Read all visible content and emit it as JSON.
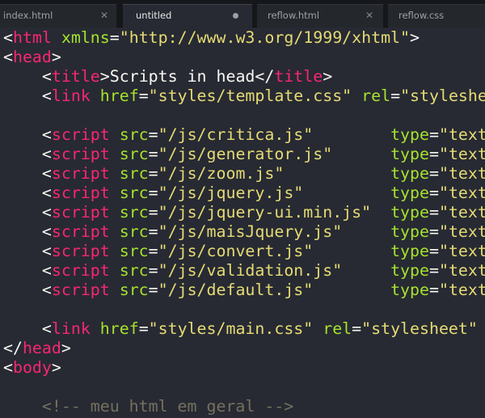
{
  "tabs": [
    {
      "label": "index.html",
      "active": false,
      "dirty": false
    },
    {
      "label": "untitled",
      "active": true,
      "dirty": true
    },
    {
      "label": "reflow.html",
      "active": false,
      "dirty": false
    },
    {
      "label": "reflow.css",
      "active": false,
      "dirty": false
    }
  ],
  "icons": {
    "close": "close-icon",
    "dirty": "unsaved-dot-icon"
  },
  "theme": {
    "tag": "#f92672",
    "attribute": "#a6e22e",
    "string": "#e6db74",
    "text": "#f8f8f2",
    "comment": "#75715e",
    "background": "#272a33"
  },
  "code_lines": [
    [
      [
        "p",
        "<"
      ],
      [
        "tag",
        "html"
      ],
      [
        "p",
        " "
      ],
      [
        "attr",
        "xmlns"
      ],
      [
        "p",
        "="
      ],
      [
        "str",
        "\"http://www.w3.org/1999/xhtml\""
      ],
      [
        "p",
        ">"
      ]
    ],
    [
      [
        "p",
        "<"
      ],
      [
        "tag",
        "head"
      ],
      [
        "p",
        ">"
      ]
    ],
    [
      [
        "p",
        "    <"
      ],
      [
        "tag",
        "title"
      ],
      [
        "p",
        ">"
      ],
      [
        "text",
        "Scripts in head"
      ],
      [
        "p",
        "</"
      ],
      [
        "tag",
        "title"
      ],
      [
        "p",
        ">"
      ]
    ],
    [
      [
        "p",
        "    <"
      ],
      [
        "tag",
        "link"
      ],
      [
        "p",
        " "
      ],
      [
        "attr",
        "href"
      ],
      [
        "p",
        "="
      ],
      [
        "str",
        "\"styles/template.css\""
      ],
      [
        "p",
        " "
      ],
      [
        "attr",
        "rel"
      ],
      [
        "p",
        "="
      ],
      [
        "str",
        "\"styleshe"
      ]
    ],
    [
      [
        "p",
        ""
      ]
    ],
    [
      [
        "p",
        "    <"
      ],
      [
        "tag",
        "script"
      ],
      [
        "p",
        " "
      ],
      [
        "attr",
        "src"
      ],
      [
        "p",
        "="
      ],
      [
        "str",
        "\"/js/critica.js\""
      ],
      [
        "p",
        "        "
      ],
      [
        "attr",
        "type"
      ],
      [
        "p",
        "="
      ],
      [
        "str",
        "\"text"
      ]
    ],
    [
      [
        "p",
        "    <"
      ],
      [
        "tag",
        "script"
      ],
      [
        "p",
        " "
      ],
      [
        "attr",
        "src"
      ],
      [
        "p",
        "="
      ],
      [
        "str",
        "\"/js/generator.js\""
      ],
      [
        "p",
        "      "
      ],
      [
        "attr",
        "type"
      ],
      [
        "p",
        "="
      ],
      [
        "str",
        "\"text"
      ]
    ],
    [
      [
        "p",
        "    <"
      ],
      [
        "tag",
        "script"
      ],
      [
        "p",
        " "
      ],
      [
        "attr",
        "src"
      ],
      [
        "p",
        "="
      ],
      [
        "str",
        "\"/js/zoom.js\""
      ],
      [
        "p",
        "           "
      ],
      [
        "attr",
        "type"
      ],
      [
        "p",
        "="
      ],
      [
        "str",
        "\"text"
      ]
    ],
    [
      [
        "p",
        "    <"
      ],
      [
        "tag",
        "script"
      ],
      [
        "p",
        " "
      ],
      [
        "attr",
        "src"
      ],
      [
        "p",
        "="
      ],
      [
        "str",
        "\"/js/jquery.js\""
      ],
      [
        "p",
        "         "
      ],
      [
        "attr",
        "type"
      ],
      [
        "p",
        "="
      ],
      [
        "str",
        "\"text"
      ]
    ],
    [
      [
        "p",
        "    <"
      ],
      [
        "tag",
        "script"
      ],
      [
        "p",
        " "
      ],
      [
        "attr",
        "src"
      ],
      [
        "p",
        "="
      ],
      [
        "str",
        "\"/js/jquery-ui.min.js\""
      ],
      [
        "p",
        "  "
      ],
      [
        "attr",
        "type"
      ],
      [
        "p",
        "="
      ],
      [
        "str",
        "\"text"
      ]
    ],
    [
      [
        "p",
        "    <"
      ],
      [
        "tag",
        "script"
      ],
      [
        "p",
        " "
      ],
      [
        "attr",
        "src"
      ],
      [
        "p",
        "="
      ],
      [
        "str",
        "\"/js/maisJquery.js\""
      ],
      [
        "p",
        "     "
      ],
      [
        "attr",
        "type"
      ],
      [
        "p",
        "="
      ],
      [
        "str",
        "\"text"
      ]
    ],
    [
      [
        "p",
        "    <"
      ],
      [
        "tag",
        "script"
      ],
      [
        "p",
        " "
      ],
      [
        "attr",
        "src"
      ],
      [
        "p",
        "="
      ],
      [
        "str",
        "\"/js/convert.js\""
      ],
      [
        "p",
        "        "
      ],
      [
        "attr",
        "type"
      ],
      [
        "p",
        "="
      ],
      [
        "str",
        "\"text"
      ]
    ],
    [
      [
        "p",
        "    <"
      ],
      [
        "tag",
        "script"
      ],
      [
        "p",
        " "
      ],
      [
        "attr",
        "src"
      ],
      [
        "p",
        "="
      ],
      [
        "str",
        "\"/js/validation.js\""
      ],
      [
        "p",
        "     "
      ],
      [
        "attr",
        "type"
      ],
      [
        "p",
        "="
      ],
      [
        "str",
        "\"text"
      ]
    ],
    [
      [
        "p",
        "    <"
      ],
      [
        "tag",
        "script"
      ],
      [
        "p",
        " "
      ],
      [
        "attr",
        "src"
      ],
      [
        "p",
        "="
      ],
      [
        "str",
        "\"/js/default.js\""
      ],
      [
        "p",
        "        "
      ],
      [
        "attr",
        "type"
      ],
      [
        "p",
        "="
      ],
      [
        "str",
        "\"text"
      ]
    ],
    [
      [
        "p",
        ""
      ]
    ],
    [
      [
        "p",
        "    <"
      ],
      [
        "tag",
        "link"
      ],
      [
        "p",
        " "
      ],
      [
        "attr",
        "href"
      ],
      [
        "p",
        "="
      ],
      [
        "str",
        "\"styles/main.css\""
      ],
      [
        "p",
        " "
      ],
      [
        "attr",
        "rel"
      ],
      [
        "p",
        "="
      ],
      [
        "str",
        "\"stylesheet\""
      ],
      [
        "p",
        " "
      ]
    ],
    [
      [
        "p",
        "</"
      ],
      [
        "tag",
        "head"
      ],
      [
        "p",
        ">"
      ]
    ],
    [
      [
        "p",
        "<"
      ],
      [
        "tag",
        "body"
      ],
      [
        "p",
        ">"
      ]
    ],
    [
      [
        "p",
        ""
      ]
    ],
    [
      [
        "p",
        "    "
      ],
      [
        "comment",
        "<!-- meu html em geral -->"
      ]
    ]
  ]
}
